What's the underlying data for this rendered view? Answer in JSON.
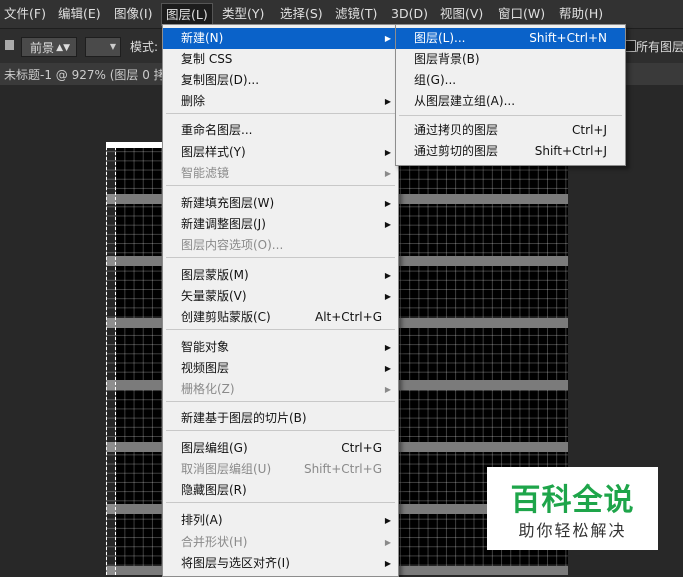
{
  "menubar": {
    "items": [
      {
        "label": "文件(F)"
      },
      {
        "label": "编辑(E)"
      },
      {
        "label": "图像(I)"
      },
      {
        "label": "图层(L)"
      },
      {
        "label": "类型(Y)"
      },
      {
        "label": "选择(S)"
      },
      {
        "label": "滤镜(T)"
      },
      {
        "label": "3D(D)"
      },
      {
        "label": "视图(V)"
      },
      {
        "label": "窗口(W)"
      },
      {
        "label": "帮助(H)"
      }
    ]
  },
  "options": {
    "foreground_label": "前景",
    "mode_label": "模式:",
    "all_layers_label": "所有图层"
  },
  "document": {
    "tab_title": "未标题-1 @ 927% (图层 0 拷"
  },
  "layer_menu": {
    "items": [
      {
        "label": "新建(N)",
        "shortcut": "",
        "submenu": true,
        "disabled": false,
        "highlight": true
      },
      {
        "label": "复制 CSS",
        "shortcut": "",
        "submenu": false,
        "disabled": false
      },
      {
        "label": "复制图层(D)...",
        "shortcut": "",
        "submenu": false,
        "disabled": false
      },
      {
        "label": "删除",
        "shortcut": "",
        "submenu": true,
        "disabled": false
      },
      {
        "label": "重命名图层...",
        "shortcut": "",
        "submenu": false,
        "disabled": false
      },
      {
        "label": "图层样式(Y)",
        "shortcut": "",
        "submenu": true,
        "disabled": false
      },
      {
        "label": "智能滤镜",
        "shortcut": "",
        "submenu": true,
        "disabled": true
      },
      {
        "label": "新建填充图层(W)",
        "shortcut": "",
        "submenu": true,
        "disabled": false
      },
      {
        "label": "新建调整图层(J)",
        "shortcut": "",
        "submenu": true,
        "disabled": false
      },
      {
        "label": "图层内容选项(O)...",
        "shortcut": "",
        "submenu": false,
        "disabled": true
      },
      {
        "label": "图层蒙版(M)",
        "shortcut": "",
        "submenu": true,
        "disabled": false
      },
      {
        "label": "矢量蒙版(V)",
        "shortcut": "",
        "submenu": true,
        "disabled": false
      },
      {
        "label": "创建剪贴蒙版(C)",
        "shortcut": "Alt+Ctrl+G",
        "submenu": false,
        "disabled": false
      },
      {
        "label": "智能对象",
        "shortcut": "",
        "submenu": true,
        "disabled": false
      },
      {
        "label": "视频图层",
        "shortcut": "",
        "submenu": true,
        "disabled": false
      },
      {
        "label": "栅格化(Z)",
        "shortcut": "",
        "submenu": true,
        "disabled": true
      },
      {
        "label": "新建基于图层的切片(B)",
        "shortcut": "",
        "submenu": false,
        "disabled": false
      },
      {
        "label": "图层编组(G)",
        "shortcut": "Ctrl+G",
        "submenu": false,
        "disabled": false
      },
      {
        "label": "取消图层编组(U)",
        "shortcut": "Shift+Ctrl+G",
        "submenu": false,
        "disabled": true
      },
      {
        "label": "隐藏图层(R)",
        "shortcut": "",
        "submenu": false,
        "disabled": false
      },
      {
        "label": "排列(A)",
        "shortcut": "",
        "submenu": true,
        "disabled": false
      },
      {
        "label": "合并形状(H)",
        "shortcut": "",
        "submenu": true,
        "disabled": true
      },
      {
        "label": "将图层与选区对齐(I)",
        "shortcut": "",
        "submenu": true,
        "disabled": false
      }
    ]
  },
  "new_submenu": {
    "items": [
      {
        "label": "图层(L)...",
        "shortcut": "Shift+Ctrl+N",
        "highlight": true
      },
      {
        "label": "图层背景(B)",
        "shortcut": ""
      },
      {
        "label": "组(G)...",
        "shortcut": ""
      },
      {
        "label": "从图层建立组(A)...",
        "shortcut": ""
      },
      {
        "label": "通过拷贝的图层",
        "shortcut": "Ctrl+J"
      },
      {
        "label": "通过剪切的图层",
        "shortcut": "Shift+Ctrl+J"
      }
    ]
  },
  "watermark": {
    "title": "百科全说",
    "subtitle": "助你轻松解决"
  },
  "colors": {
    "highlight": "#0a62c9",
    "menu_bg": "#f0f0f0",
    "watermark_green": "#1ea54a"
  }
}
